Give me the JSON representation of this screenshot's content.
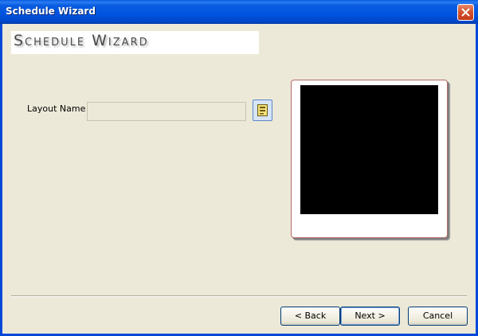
{
  "window": {
    "title": "Schedule Wizard",
    "close_icon": "close-icon"
  },
  "banner": {
    "title": "Schedule Wizard"
  },
  "form": {
    "layout_label": "Layout Name",
    "layout_value": "",
    "browse_icon": "browse-layout-icon"
  },
  "preview": {
    "screen_color": "#000000"
  },
  "buttons": {
    "back": "< Back",
    "next": "Next >",
    "cancel": "Cancel"
  },
  "colors": {
    "titlebar": "#0053e0",
    "background": "#ece9d8",
    "close_button": "#d5532e"
  }
}
